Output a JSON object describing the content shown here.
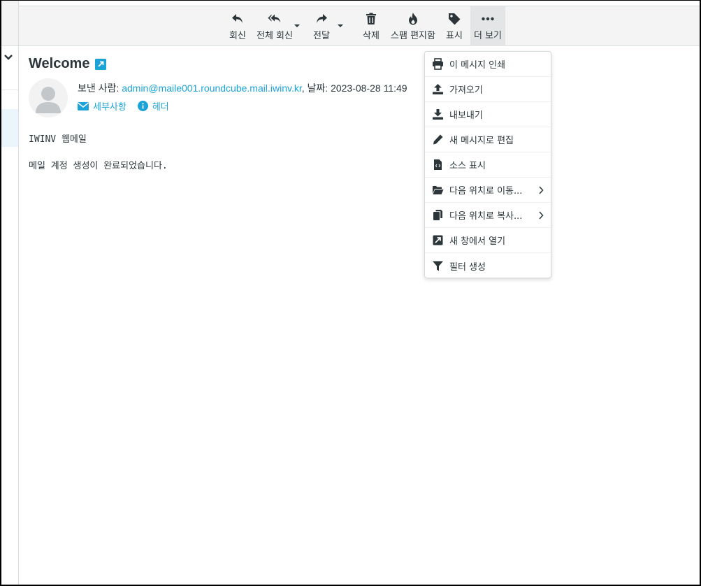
{
  "toolbar": {
    "reply": "회신",
    "reply_all": "전체 회신",
    "forward": "전달",
    "delete": "삭제",
    "spam": "스팸 편지함",
    "mark": "표시",
    "more": "더 보기"
  },
  "message": {
    "subject": "Welcome",
    "from_label": "보낸 사람:",
    "from_address": "admin@maile001.roundcube.mail.iwinv.kr",
    "date_label": ", 날짜:",
    "date_value": "2023-08-28 11:49",
    "details_link": "세부사항",
    "headers_link": "헤더",
    "body_line1": "IWINV 웹메일",
    "body_line2": "메일 계정 생성이 완료되었습니다."
  },
  "more_menu": {
    "items": [
      {
        "label": "이 메시지 인쇄",
        "icon": "print-icon"
      },
      {
        "label": "가져오기",
        "icon": "upload-icon"
      },
      {
        "label": "내보내기",
        "icon": "download-icon"
      },
      {
        "label": "새 메시지로 편집",
        "icon": "pencil-icon"
      },
      {
        "label": "소스 표시",
        "icon": "source-file-icon"
      },
      {
        "label": "다음 위치로 이동...",
        "icon": "folder-open-icon"
      },
      {
        "label": "다음 위치로 복사...",
        "icon": "copy-icon"
      },
      {
        "label": "새 창에서 열기",
        "icon": "external-window-icon"
      },
      {
        "label": "필터 생성",
        "icon": "filter-icon"
      }
    ]
  },
  "colors": {
    "accent": "#1aa3d9",
    "toolbar_bg": "#f4f4f4",
    "text": "#2c363a"
  }
}
